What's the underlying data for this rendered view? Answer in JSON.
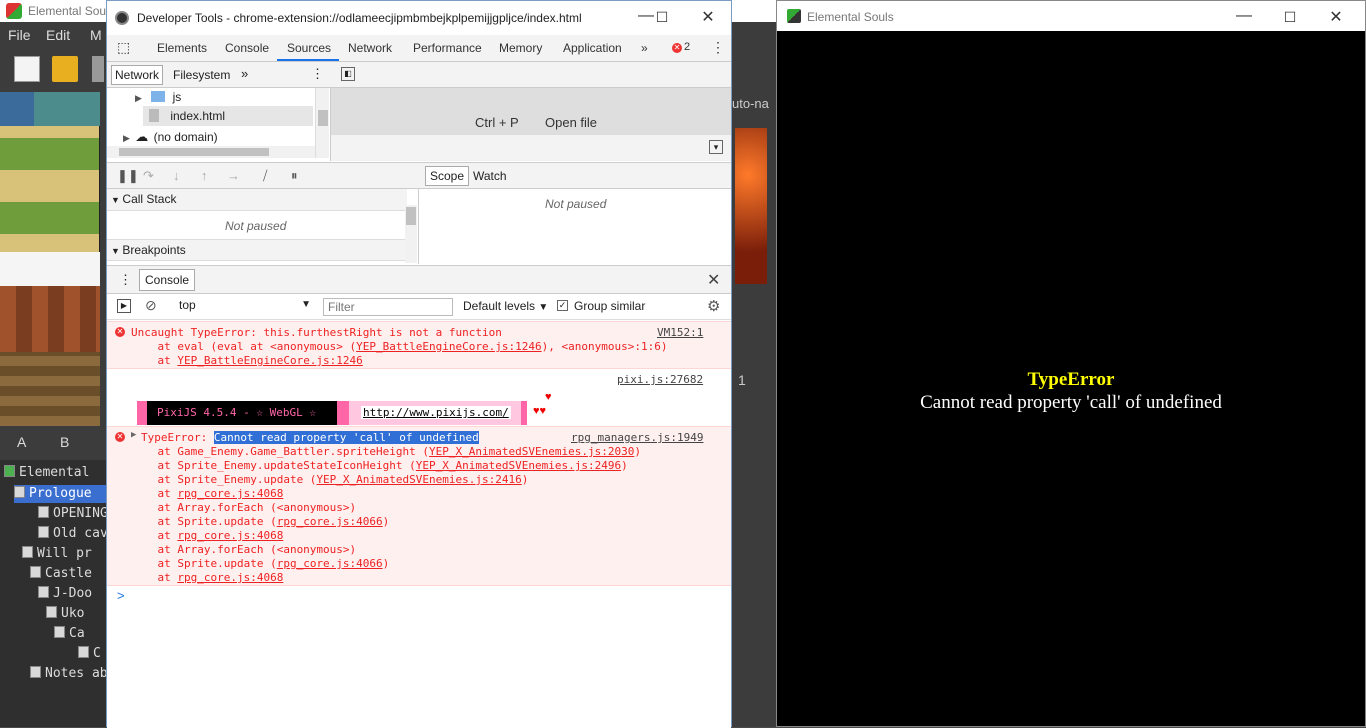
{
  "background_app": {
    "title": "Elemental Sou",
    "menu": [
      "File",
      "Edit",
      "M"
    ],
    "tabs": [
      "A",
      "B"
    ],
    "tree": [
      "Elemental",
      "Prologue",
      "OPENING",
      "Old cav",
      "Will pr",
      "Castle",
      "J-Doo",
      "Uko",
      "Ca",
      "C",
      "Notes ab"
    ],
    "automap_label": "uto-na",
    "side_number": "1"
  },
  "devtools": {
    "title": "Developer Tools - chrome-extension://odlameecjipmbmbejkplpemijjgpljce/index.html",
    "tabs": [
      "Elements",
      "Console",
      "Sources",
      "Network",
      "Performance",
      "Memory",
      "Application"
    ],
    "more": "»",
    "error_count": "2",
    "navigator": {
      "tabs": [
        "Network",
        "Filesystem"
      ],
      "more": "»",
      "items": [
        "js",
        "index.html",
        "(no domain)"
      ]
    },
    "editor": {
      "shortcut": "Ctrl + P",
      "action": "Open file"
    },
    "debugger": {
      "call_stack": "Call Stack",
      "not_paused": "Not paused",
      "breakpoints": "Breakpoints",
      "scope_tabs": [
        "Scope",
        "Watch"
      ],
      "scope_not_paused": "Not paused"
    },
    "console": {
      "drawer_tab": "Console",
      "context": "top",
      "filter_placeholder": "Filter",
      "levels": "Default levels",
      "group_similar": "Group similar",
      "error1": {
        "line1": "Uncaught TypeError: this.furthestRight is not a function",
        "source": "VM152:1",
        "line2_pre": "    at eval (eval at <anonymous> (",
        "line2_link": "YEP_BattleEngineCore.js:1246",
        "line2_post": "), <anonymous>:1:6)",
        "line3_pre": "    at ",
        "line3_link": "YEP_BattleEngineCore.js:1246"
      },
      "pixi": {
        "source": "pixi.js:27682",
        "banner": "PixiJS 4.5.4 - ☆ WebGL ☆",
        "url": "http://www.pixijs.com/",
        "hearts": "♥"
      },
      "error2": {
        "prefix": "TypeError: ",
        "highlight": "Cannot read property 'call' of undefined",
        "source": "rpg_managers.js:1949",
        "stack": [
          {
            "pre": "    at Game_Enemy.Game_Battler.spriteHeight (",
            "link": "YEP_X_AnimatedSVEnemies.js:2030",
            "post": ")"
          },
          {
            "pre": "    at Sprite_Enemy.updateStateIconHeight (",
            "link": "YEP_X_AnimatedSVEnemies.js:2496",
            "post": ")"
          },
          {
            "pre": "    at Sprite_Enemy.update (",
            "link": "YEP_X_AnimatedSVEnemies.js:2416",
            "post": ")"
          },
          {
            "pre": "    at ",
            "link": "rpg_core.js:4068",
            "post": ""
          },
          {
            "pre": "    at Array.forEach (<anonymous>)",
            "link": "",
            "post": ""
          },
          {
            "pre": "    at Sprite.update (",
            "link": "rpg_core.js:4066",
            "post": ")"
          },
          {
            "pre": "    at ",
            "link": "rpg_core.js:4068",
            "post": ""
          },
          {
            "pre": "    at Array.forEach (<anonymous>)",
            "link": "",
            "post": ""
          },
          {
            "pre": "    at Sprite.update (",
            "link": "rpg_core.js:4066",
            "post": ")"
          },
          {
            "pre": "    at ",
            "link": "rpg_core.js:4068",
            "post": ""
          }
        ]
      },
      "prompt": ">"
    }
  },
  "game": {
    "title": "Elemental Souls",
    "error_title": "TypeError",
    "error_message": "Cannot read property 'call' of undefined"
  }
}
